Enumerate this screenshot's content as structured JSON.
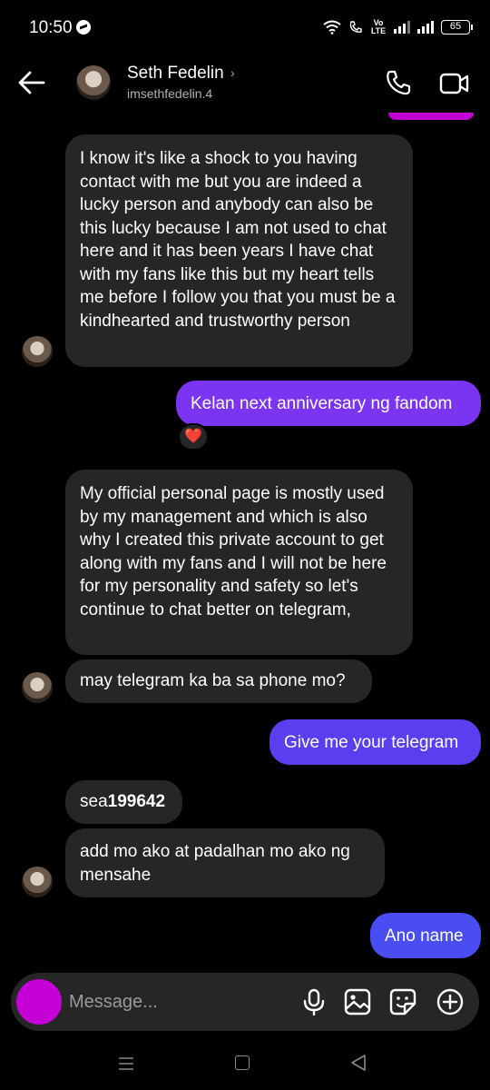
{
  "status_bar": {
    "time": "10:50",
    "volte": "Vo LTE",
    "battery": "65",
    "icons": [
      "messenger-icon",
      "wifi-icon",
      "call-icon",
      "signal-icon",
      "battery-icon"
    ]
  },
  "header": {
    "name": "Seth Fedelin",
    "username": "imsethfedelin.4",
    "chevron": "›",
    "icons": [
      "back-arrow-icon",
      "phone-icon",
      "video-camera-icon"
    ]
  },
  "messages": [
    {
      "side": "incoming",
      "text": "I know it's like a shock to you having contact with me but you are indeed a lucky person and anybody can also be this lucky because I am not used to chat here and it has been years I have chat with my fans like this but my heart tells me before I follow you that you must be a kindhearted and trustworthy person"
    },
    {
      "side": "outgoing",
      "text": "Kelan next anniversary ng fandom",
      "color": "#7b35f0",
      "reaction": "❤️"
    },
    {
      "side": "incoming",
      "text": "My official personal page is mostly used by my management and which is also why I created this private account to get along with my fans and I will not be here for my personality and safety so let's continue to chat better on telegram,"
    },
    {
      "side": "incoming",
      "text": "may telegram ka ba sa phone mo?"
    },
    {
      "side": "outgoing",
      "text": "Give me your telegram",
      "color": "#5a3ff0"
    },
    {
      "side": "incoming",
      "text_prefix": "sea",
      "text_bold": "199642"
    },
    {
      "side": "incoming",
      "text": "add mo ako at padalhan mo ako ng mensahe"
    },
    {
      "side": "outgoing",
      "text": "Ano name",
      "color": "#4a4df2"
    }
  ],
  "composer": {
    "placeholder": "Message...",
    "icons": [
      "microphone-icon",
      "gallery-icon",
      "sticker-icon",
      "add-icon"
    ]
  },
  "colors": {
    "background": "#000000",
    "incoming_bubble": "#262626",
    "camera_button": "#c400d6"
  }
}
